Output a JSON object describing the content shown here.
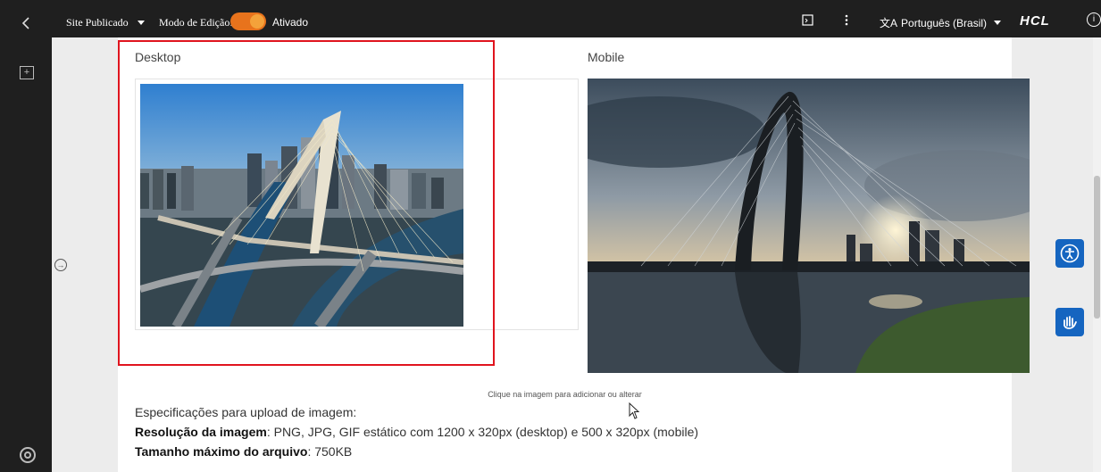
{
  "topbar": {
    "site_status": "Site Publicado",
    "edit_mode_label": "Modo de Edição:",
    "edit_mode_state": "Ativado",
    "language": "Português (Brasil)",
    "brand": "HCL"
  },
  "content": {
    "desktop_label": "Desktop",
    "mobile_label": "Mobile",
    "hint": "Clique na imagem para adicionar ou alterar",
    "spec_title": "Especificações para upload de imagem:",
    "resolution_label": "Resolução da imagem",
    "resolution_value": ": PNG, JPG, GIF estático com 1200 x 320px (desktop) e 500 x 320px (mobile)",
    "maxsize_label": "Tamanho máximo do arquivo",
    "maxsize_value": ": 750KB"
  },
  "colors": {
    "topbar_bg": "#1f1f1f",
    "toggle_on": "#e8731c",
    "highlight_box": "#e0141e",
    "a11y_blue": "#1565c0"
  },
  "icons": [
    "back-icon",
    "add-section-icon",
    "expand-arrow-icon",
    "support-icon",
    "preview-icon",
    "more-icon",
    "translate-icon",
    "info-icon",
    "accessibility-icon",
    "sign-language-icon"
  ]
}
